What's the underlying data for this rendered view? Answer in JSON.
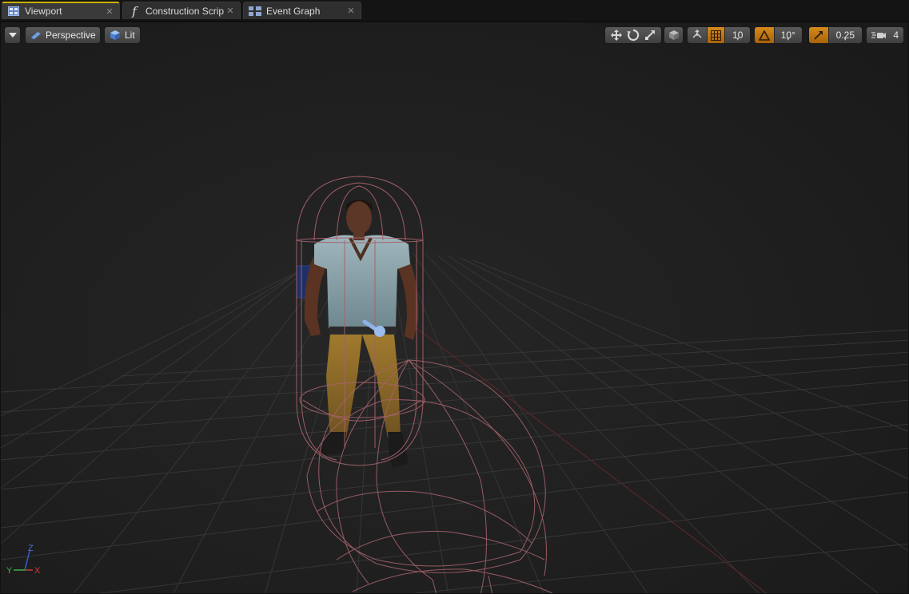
{
  "tabs": [
    {
      "label": "Viewport",
      "icon": "viewport-icon",
      "active": true
    },
    {
      "label": "Construction Scrip",
      "icon": "function-icon",
      "active": false
    },
    {
      "label": "Event Graph",
      "icon": "event-graph-icon",
      "active": false
    }
  ],
  "toolbar": {
    "view_mode_label": "Perspective",
    "lighting_label": "Lit",
    "grid_snap_value": "10",
    "rotation_snap_value": "10°",
    "scale_snap_value": "0.25",
    "camera_speed_value": "4"
  },
  "axis": {
    "y": "Y",
    "x": "X",
    "z": "Z"
  },
  "colors": {
    "accent_orange": "#c07a16",
    "tab_highlight": "#c8b200",
    "capsule_wire": "#b26a74",
    "grid_line": "#3a3a3a",
    "x_axis_line": "#7a2a2a"
  }
}
